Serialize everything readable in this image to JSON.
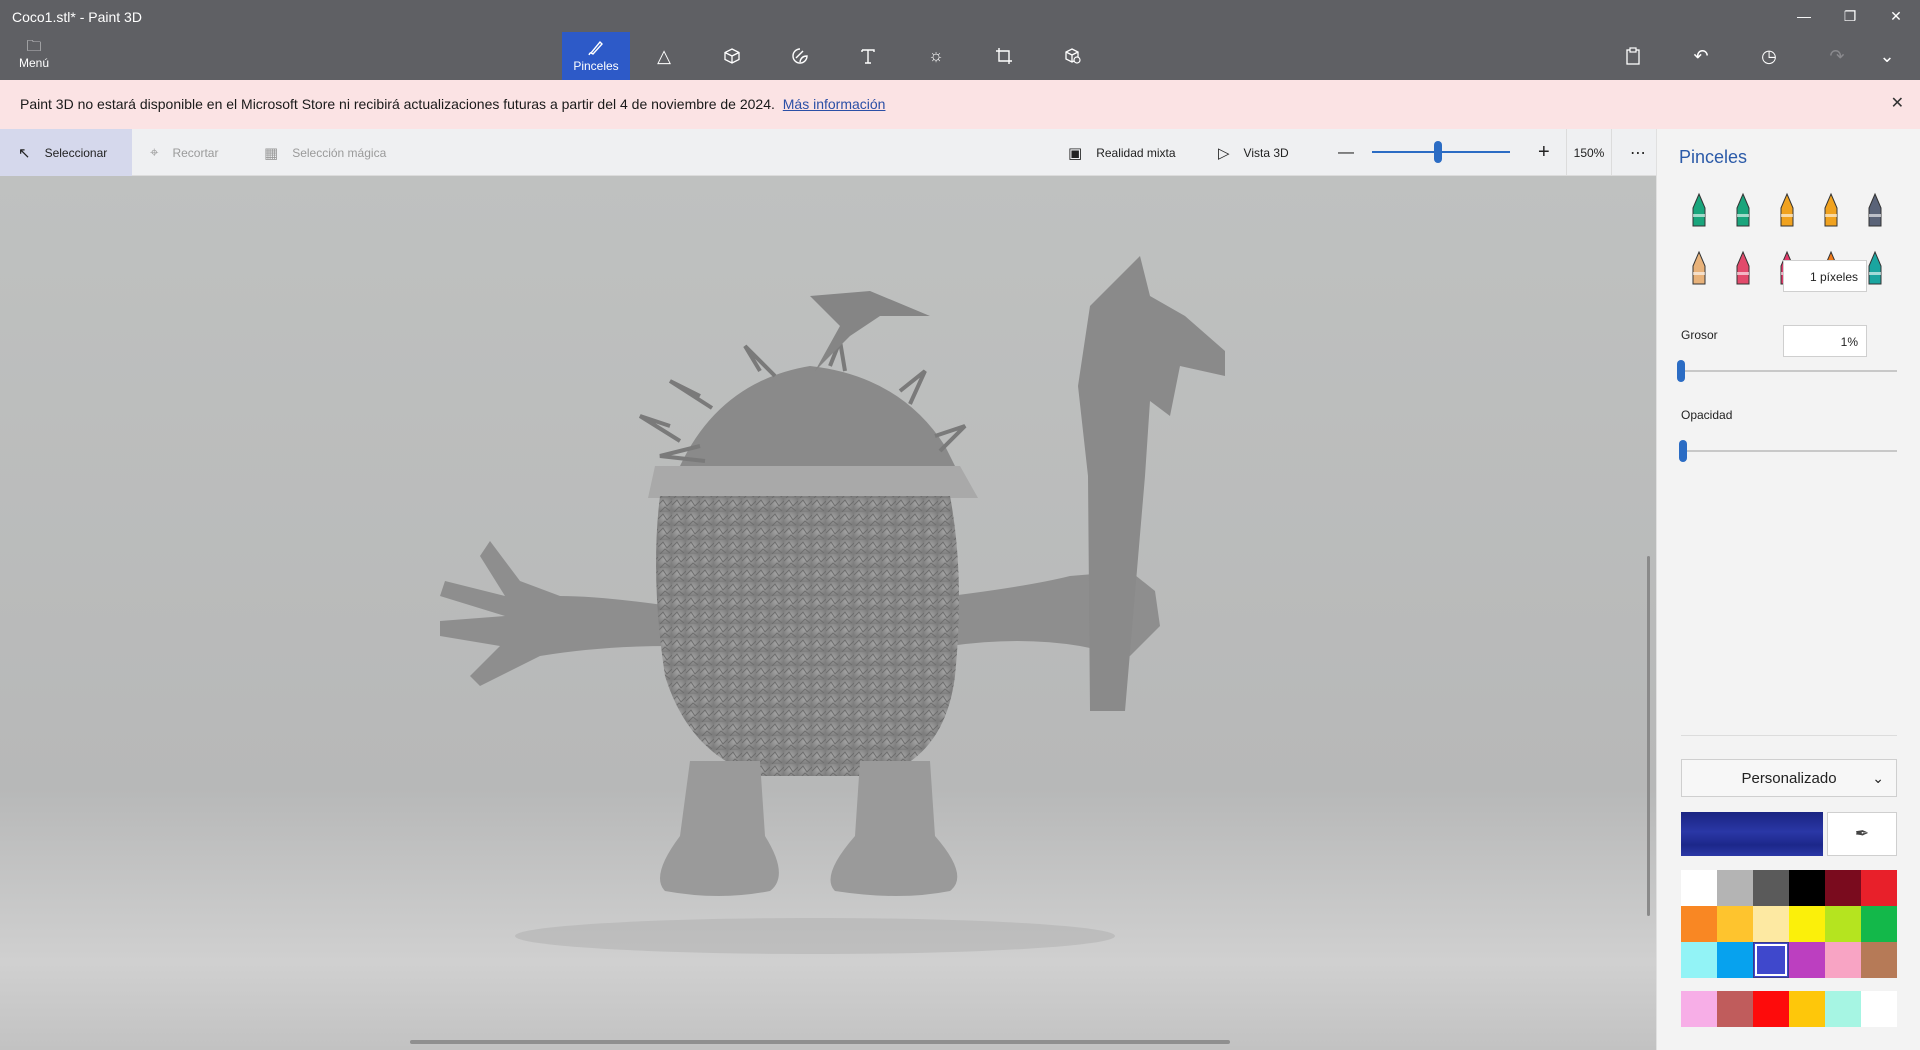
{
  "window": {
    "title": "Coco1.stl* - Paint 3D",
    "minimize_icon": "minimize-icon",
    "restore_icon": "restore-icon",
    "close_icon": "close-icon"
  },
  "ribbon": {
    "menu_label": "Menú",
    "tools": [
      {
        "name": "brushes",
        "label": "Pinceles",
        "icon": "brush-icon",
        "active": true
      },
      {
        "name": "2d-shapes",
        "label": "",
        "icon": "shapes-2d-icon"
      },
      {
        "name": "3d-shapes",
        "label": "",
        "icon": "cube-icon"
      },
      {
        "name": "stickers",
        "label": "",
        "icon": "sticker-icon"
      },
      {
        "name": "text",
        "label": "",
        "icon": "text-icon"
      },
      {
        "name": "effects",
        "label": "",
        "icon": "sun-icon"
      },
      {
        "name": "canvas",
        "label": "",
        "icon": "crop-canvas-icon"
      },
      {
        "name": "3d-library",
        "label": "",
        "icon": "library-3d-icon"
      }
    ],
    "right_tools": [
      "paste-icon",
      "undo-icon",
      "history-icon",
      "redo-icon",
      "expand-icon"
    ]
  },
  "banner": {
    "message": "Paint 3D no estará disponible en el Microsoft Store ni recibirá actualizaciones futuras a partir del 4 de noviembre de 2024.",
    "link": "Más información"
  },
  "commandbar": {
    "select": "Seleccionar",
    "crop": "Recortar",
    "magic_select": "Selección mágica",
    "mixed_reality": "Realidad mixta",
    "view_3d": "Vista 3D",
    "zoom": "150%",
    "zoom_level_fraction": 0.48
  },
  "panel": {
    "title": "Pinceles",
    "brushes": [
      {
        "name": "marker",
        "color": "#1aa57c"
      },
      {
        "name": "calligraphy-pen",
        "color": "#1aa57c"
      },
      {
        "name": "oil-brush",
        "color": "#f0a21f"
      },
      {
        "name": "watercolor",
        "color": "#f0a21f"
      },
      {
        "name": "pixel-pen",
        "color": "#5a6378"
      },
      {
        "name": "pencil",
        "color": "#e8b27a"
      },
      {
        "name": "eraser",
        "color": "#e24a6b"
      },
      {
        "name": "crayon",
        "color": "#e23a6a"
      },
      {
        "name": "spray-can",
        "color": "#ef7a1a"
      },
      {
        "name": "fill",
        "color": "#1aa5a0"
      }
    ],
    "thickness_label": "Grosor",
    "thickness_value": "1 píxeles",
    "thickness_fraction": 0.0,
    "opacity_label": "Opacidad",
    "opacity_value": "1%",
    "opacity_fraction": 0.01,
    "color_mode": "Personalizado",
    "current_color": "#2a37a6",
    "palette": [
      "#ffffff",
      "#b4b4b4",
      "#5a5a5a",
      "#000000",
      "#7a0b1e",
      "#e8202a",
      "#f98723",
      "#fec42e",
      "#fde9a2",
      "#fbf00a",
      "#b5e41f",
      "#13b84a",
      "#92f3f6",
      "#07a2ee",
      "#3f48cc",
      "#bc3fc0",
      "#f8a4c4",
      "#b67a57"
    ],
    "selected_palette_index": 14,
    "custom_colors": [
      "#f7aee7",
      "#c05c5c",
      "#fe0b0b",
      "#fec70a",
      "#a6f5e3",
      "#ffffff"
    ]
  }
}
